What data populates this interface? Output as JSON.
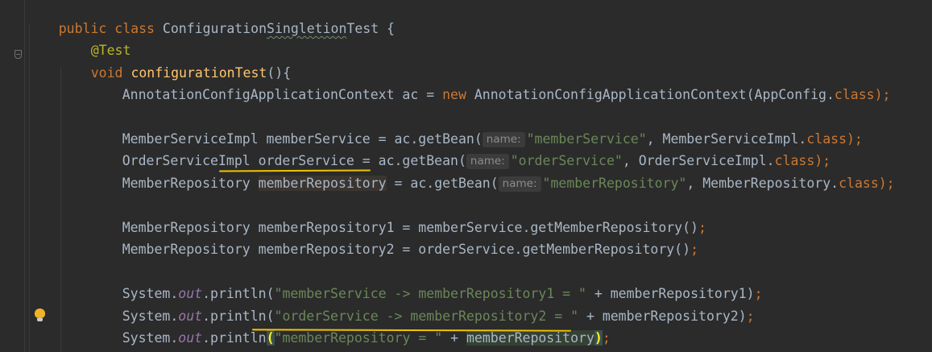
{
  "editor": {
    "lines": [
      {
        "tokens": [
          {
            "t": "public",
            "c": "kw"
          },
          {
            "t": " ",
            "c": "plain"
          },
          {
            "t": "class",
            "c": "kw"
          },
          {
            "t": " ConfigurationSingletionTest {",
            "c": "plain"
          }
        ]
      }
    ],
    "class_decl": {
      "kw1": "public",
      "kw2": "class",
      "name_a": "Configuration",
      "name_b": "Singletion",
      "name_c": "Test {"
    },
    "annotation": "@Test",
    "method_decl": {
      "kw": "void",
      "name": "configurationTest",
      "rest": "(){"
    },
    "line_ctx": {
      "a": "AnnotationConfigApplicationContext ac = ",
      "kw": "new",
      "b": " AnnotationConfigApplicationContext(AppConfig.",
      "cls": "class",
      "end": ");"
    },
    "line_member_service": {
      "a": "MemberServiceImpl memberService = ac.getBean(",
      "hint": "name:",
      "str": "\"memberService\"",
      "b": ", MemberServiceImpl.",
      "cls": "class",
      "end": ");"
    },
    "line_order_service": {
      "a": "OrderServiceImpl orderService = ac.getBean(",
      "hint": "name:",
      "str": "\"orderService\"",
      "b": ", OrderServiceImpl.",
      "cls": "class",
      "end": ");"
    },
    "line_member_repo": {
      "a": "MemberRepository ",
      "var": "memberRepository",
      "b": " = ac.getBean(",
      "hint": "name:",
      "str": "\"memberRepository\"",
      "c": ", MemberRepository.",
      "cls": "class",
      "end": ");"
    },
    "line_repo1": {
      "a": "MemberRepository memberRepository1 = memberService.getMemberRepository()",
      "end": ";"
    },
    "line_repo2": {
      "a": "MemberRepository memberRepository2 = orderService.getMemberRepository()",
      "end": ";"
    },
    "line_print1": {
      "a": "System.",
      "field": "out",
      "b": ".println(",
      "str": "\"memberService -> memberRepository1 = \"",
      "c": " + memberRepository1)",
      "end": ";"
    },
    "line_print2": {
      "a": "System.",
      "field": "out",
      "b": ".println(",
      "str": "\"orderService -> memberRepository2 = \"",
      "c": " + memberRepository2)",
      "end": ";"
    },
    "line_print3": {
      "a": "System.",
      "field": "out",
      "b": ".println",
      "open": "(",
      "str": "\"memberRepository = \"",
      "c": " + ",
      "var": "memberRepository",
      "close": ")",
      "end": ";"
    }
  },
  "icons": {
    "fold": "fold-marker-icon",
    "intention": "lightbulb-icon"
  },
  "colors": {
    "background": "#2b2b2b",
    "keyword": "#cc7832",
    "string": "#6a8759",
    "method": "#ffc66d",
    "annotation": "#bbb529",
    "field": "#9876aa",
    "text": "#a9b7c6",
    "marker": "#f0c400"
  }
}
